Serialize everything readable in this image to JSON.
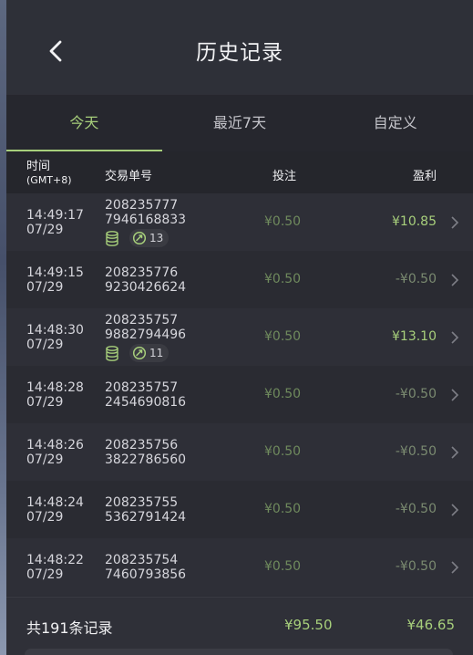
{
  "header": {
    "title": "历史记录",
    "back_icon": "chevron-left-icon"
  },
  "tabs": [
    {
      "label": "今天",
      "active": true
    },
    {
      "label": "最近7天",
      "active": false
    },
    {
      "label": "自定义",
      "active": false
    }
  ],
  "columns": {
    "time": "时间",
    "timezone": "(GMT+8)",
    "order": "交易单号",
    "bet": "投注",
    "profit": "盈利"
  },
  "rows": [
    {
      "time": "14:49:17",
      "date": "07/29",
      "order_a": "208235777",
      "order_b": "7946168833",
      "bet": "¥0.50",
      "profit": "¥10.85",
      "win": true,
      "count": "13"
    },
    {
      "time": "14:49:15",
      "date": "07/29",
      "order_a": "208235776",
      "order_b": "9230426624",
      "bet": "¥0.50",
      "profit": "-¥0.50",
      "win": false,
      "count": ""
    },
    {
      "time": "14:48:30",
      "date": "07/29",
      "order_a": "208235757",
      "order_b": "9882794496",
      "bet": "¥0.50",
      "profit": "¥13.10",
      "win": true,
      "count": "11"
    },
    {
      "time": "14:48:28",
      "date": "07/29",
      "order_a": "208235757",
      "order_b": "2454690816",
      "bet": "¥0.50",
      "profit": "-¥0.50",
      "win": false,
      "count": ""
    },
    {
      "time": "14:48:26",
      "date": "07/29",
      "order_a": "208235756",
      "order_b": "3822786560",
      "bet": "¥0.50",
      "profit": "-¥0.50",
      "win": false,
      "count": ""
    },
    {
      "time": "14:48:24",
      "date": "07/29",
      "order_a": "208235755",
      "order_b": "5362791424",
      "bet": "¥0.50",
      "profit": "-¥0.50",
      "win": false,
      "count": ""
    },
    {
      "time": "14:48:22",
      "date": "07/29",
      "order_a": "208235754",
      "order_b": "7460793856",
      "bet": "¥0.50",
      "profit": "-¥0.50",
      "win": false,
      "count": ""
    }
  ],
  "footer": {
    "count_label": "共191条记录",
    "total_bet": "¥95.50",
    "total_profit": "¥46.65"
  },
  "colors": {
    "accent": "#a7cf7b",
    "muted_green": "#6f8a5d",
    "background": "#2b2c33"
  }
}
